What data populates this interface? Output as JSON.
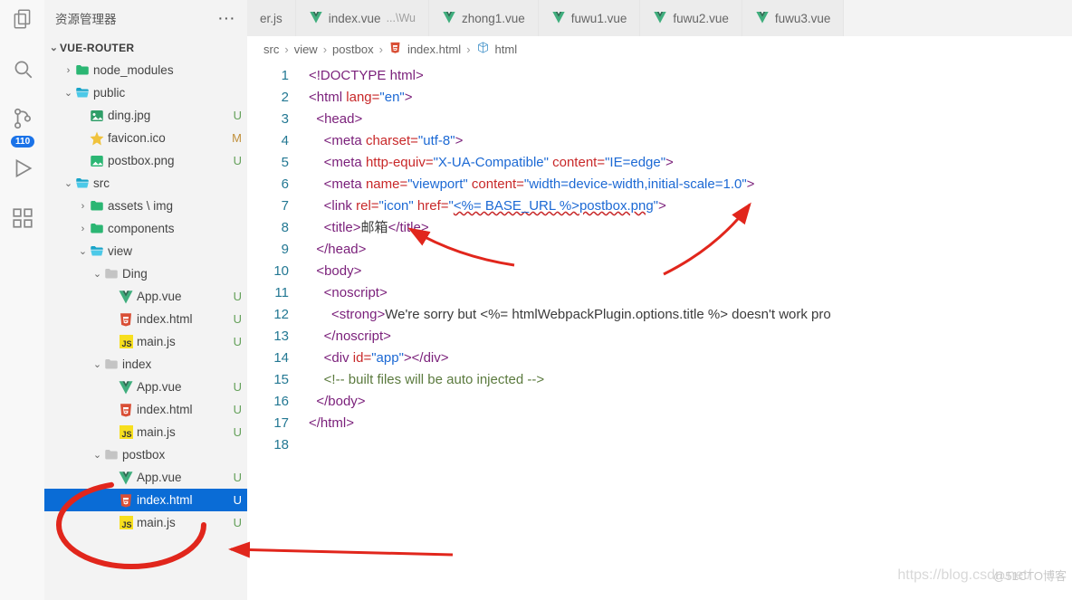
{
  "activity_badge": "110",
  "sidebar": {
    "title": "资源管理器",
    "root": "VUE-ROUTER",
    "tree": [
      {
        "d": 1,
        "c": "closed",
        "ico": "dir-green",
        "name": "node_modules",
        "git": ""
      },
      {
        "d": 1,
        "c": "open",
        "ico": "dir-open",
        "name": "public",
        "git": ""
      },
      {
        "d": 2,
        "c": "",
        "ico": "img",
        "name": "ding.jpg",
        "git": "U"
      },
      {
        "d": 2,
        "c": "",
        "ico": "star",
        "name": "favicon.ico",
        "git": "M"
      },
      {
        "d": 2,
        "c": "",
        "ico": "png",
        "name": "postbox.png",
        "git": "U"
      },
      {
        "d": 1,
        "c": "open",
        "ico": "dir-open",
        "name": "src",
        "git": ""
      },
      {
        "d": 2,
        "c": "closed",
        "ico": "dir-green",
        "name": "assets \\ img",
        "git": ""
      },
      {
        "d": 2,
        "c": "closed",
        "ico": "dir-green",
        "name": "components",
        "git": ""
      },
      {
        "d": 2,
        "c": "open",
        "ico": "dir-open",
        "name": "view",
        "git": ""
      },
      {
        "d": 3,
        "c": "open",
        "ico": "dir",
        "name": "Ding",
        "git": ""
      },
      {
        "d": 4,
        "c": "",
        "ico": "vue",
        "name": "App.vue",
        "git": "U"
      },
      {
        "d": 4,
        "c": "",
        "ico": "html",
        "name": "index.html",
        "git": "U"
      },
      {
        "d": 4,
        "c": "",
        "ico": "js",
        "name": "main.js",
        "git": "U"
      },
      {
        "d": 3,
        "c": "open",
        "ico": "dir",
        "name": "index",
        "git": ""
      },
      {
        "d": 4,
        "c": "",
        "ico": "vue",
        "name": "App.vue",
        "git": "U"
      },
      {
        "d": 4,
        "c": "",
        "ico": "html",
        "name": "index.html",
        "git": "U"
      },
      {
        "d": 4,
        "c": "",
        "ico": "js",
        "name": "main.js",
        "git": "U"
      },
      {
        "d": 3,
        "c": "open",
        "ico": "dir",
        "name": "postbox",
        "git": ""
      },
      {
        "d": 4,
        "c": "",
        "ico": "vue",
        "name": "App.vue",
        "git": "U"
      },
      {
        "d": 4,
        "c": "",
        "ico": "html",
        "name": "index.html",
        "git": "U",
        "sel": true
      },
      {
        "d": 4,
        "c": "",
        "ico": "js",
        "name": "main.js",
        "git": "U"
      }
    ]
  },
  "tabs": [
    {
      "ico": "",
      "label": "er.js"
    },
    {
      "ico": "vue",
      "label": "index.vue",
      "suffix": "...\\Wu"
    },
    {
      "ico": "vue",
      "label": "zhong1.vue"
    },
    {
      "ico": "vue",
      "label": "fuwu1.vue"
    },
    {
      "ico": "vue",
      "label": "fuwu2.vue"
    },
    {
      "ico": "vue",
      "label": "fuwu3.vue"
    }
  ],
  "breadcrumbs": [
    "src",
    "view",
    "postbox",
    "index.html",
    "html"
  ],
  "code_lines": 18,
  "code": {
    "l1": "<!DOCTYPE html>",
    "l2a": "<html",
    "l2b": " lang=",
    "l2c": "\"en\"",
    "l2d": ">",
    "l3": "  <head>",
    "l4a": "    <meta",
    "l4b": " charset=",
    "l4c": "\"utf-8\"",
    "l4d": ">",
    "l5a": "    <meta",
    "l5b": " http-equiv=",
    "l5c": "\"X-UA-Compatible\"",
    "l5d": " content=",
    "l5e": "\"IE=edge\"",
    "l5f": ">",
    "l6a": "    <meta",
    "l6b": " name=",
    "l6c": "\"viewport\"",
    "l6d": " content=",
    "l6e": "\"width=device-width,initial-scale=1.0\"",
    "l6f": ">",
    "l7a": "    <link",
    "l7b": " rel=",
    "l7c": "\"icon\"",
    "l7d": " href=",
    "l7e": "\"",
    "l7f": "<%= BASE_URL %>",
    "l7g": "postbox.png",
    "l7h": "\"",
    "l7i": ">",
    "l8a": "    <title>",
    "l8b": "邮箱",
    "l8c": "</title>",
    "l9": "  </head>",
    "l10": "  <body>",
    "l11": "    <noscript>",
    "l12a": "      <strong>",
    "l12b": "We're sorry but <%= htmlWebpackPlugin.options.title %> doesn't work pro",
    "l12c": "",
    "l13": "    </noscript>",
    "l14a": "    <div",
    "l14b": " id=",
    "l14c": "\"app\"",
    "l14d": "></div>",
    "l15": "    <!-- built files will be auto injected -->",
    "l16": "  </body>",
    "l17": "</html>"
  },
  "watermark": "https://blog.csdn.net/",
  "watermark2": "@51CTO博客"
}
